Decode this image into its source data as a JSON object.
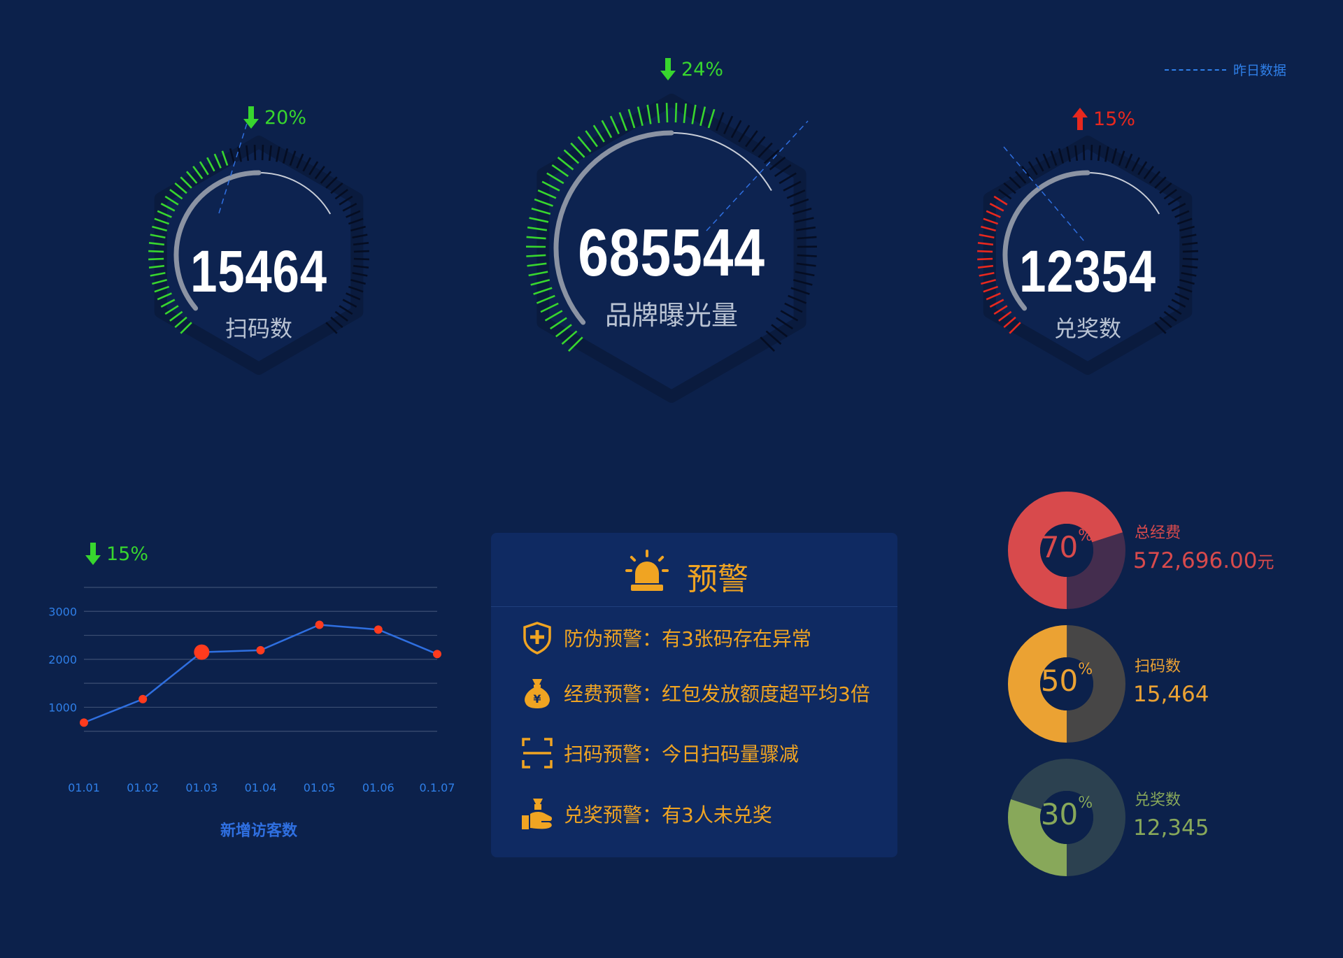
{
  "legend": {
    "label": "昨日数据"
  },
  "gauges": [
    {
      "value": "15464",
      "label": "扫码数",
      "delta": "20%",
      "direction": "down",
      "color": "#38d62e",
      "fraction": 0.43
    },
    {
      "value": "685544",
      "label": "品牌曝光量",
      "delta": "24%",
      "direction": "down",
      "color": "#38d62e",
      "fraction": 0.57
    },
    {
      "value": "12354",
      "label": "兑奖数",
      "delta": "15%",
      "direction": "up",
      "color": "#e8281e",
      "fraction": 0.3
    }
  ],
  "line_chart": {
    "delta": "15%",
    "direction": "down",
    "title": "新增访客数"
  },
  "chart_data": {
    "type": "line",
    "categories": [
      "01.01",
      "01.02",
      "01.03",
      "01.04",
      "01.05",
      "01.06",
      "0.1.07"
    ],
    "series": [
      {
        "values": [
          680,
          1170,
          2150,
          2190,
          2720,
          2620,
          2110
        ]
      }
    ],
    "yticks": [
      "1000",
      "2000",
      "3000"
    ],
    "ylim": [
      0,
      3500
    ],
    "title": "新增访客数",
    "grid": true,
    "line_color": "#2f6fe0",
    "point_color": "#ff3b1e"
  },
  "warning": {
    "title": "预警",
    "items": [
      {
        "icon": "shield-plus-icon",
        "label": "防伪预警",
        "text": "：有3张码存在异常"
      },
      {
        "icon": "money-bag-icon",
        "label": "经费预警",
        "text": "：红包发放额度超平均3倍"
      },
      {
        "icon": "scan-icon",
        "label": "扫码预警",
        "text": "：今日扫码量骤减"
      },
      {
        "icon": "hand-coin-icon",
        "label": "兑奖预警",
        "text": "：有3人未兑奖"
      }
    ]
  },
  "donuts": [
    {
      "percent": "70",
      "pct_sign": "%",
      "fraction": 0.7,
      "label": "总经费",
      "value": "572,696.00",
      "unit": "元",
      "color": "#d84a4c",
      "track": "#442d4e",
      "text_color": "#d84a4c"
    },
    {
      "percent": "50",
      "pct_sign": "%",
      "fraction": 0.5,
      "label": "扫码数",
      "value": "15,464",
      "unit": "",
      "color": "#eba233",
      "track": "#474646",
      "text_color": "#eba233"
    },
    {
      "percent": "30",
      "pct_sign": "%",
      "fraction": 0.3,
      "label": "兑奖数",
      "value": "12,345",
      "unit": "",
      "color": "#88a85a",
      "track": "#2c4150",
      "text_color": "#88a85a"
    }
  ]
}
